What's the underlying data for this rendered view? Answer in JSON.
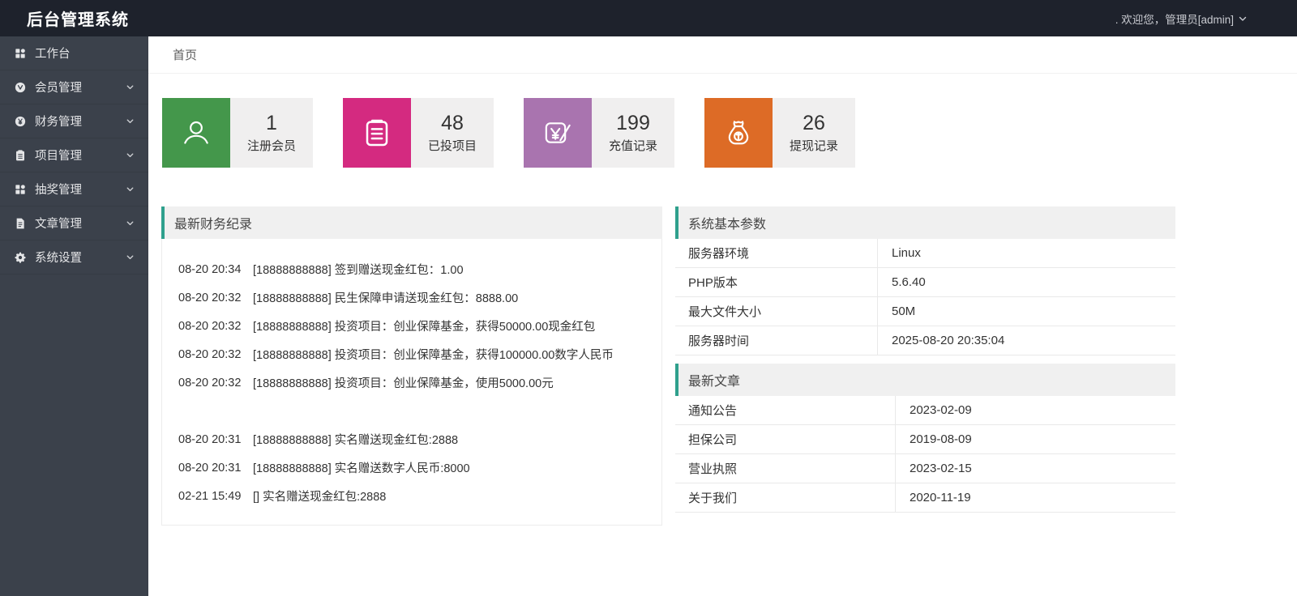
{
  "header": {
    "title": "后台管理系统",
    "user": {
      "greeting": ". 欢迎您，管理员[admin]",
      "chevron_icon": "chevron-down-icon"
    }
  },
  "sidebar": {
    "items": [
      {
        "icon": "dashboard-grid-icon",
        "label": "工作台",
        "expandable": false
      },
      {
        "icon": "member-badge-icon",
        "label": "会员管理",
        "expandable": true
      },
      {
        "icon": "finance-coin-icon",
        "label": "财务管理",
        "expandable": true
      },
      {
        "icon": "clipboard-icon",
        "label": "项目管理",
        "expandable": true
      },
      {
        "icon": "lottery-grid-icon",
        "label": "抽奖管理",
        "expandable": true
      },
      {
        "icon": "document-icon",
        "label": "文章管理",
        "expandable": true
      },
      {
        "icon": "gear-icon",
        "label": "系统设置",
        "expandable": true
      }
    ],
    "chevron_icon": "chevron-down-icon"
  },
  "breadcrumb": {
    "current": "首页"
  },
  "stat_cards": [
    {
      "icon": "user-icon",
      "color": "#44974b",
      "value": "1",
      "label": "注册会员"
    },
    {
      "icon": "clipboard-lines-icon",
      "color": "#d42a80",
      "value": "48",
      "label": "已投项目"
    },
    {
      "icon": "yen-edit-icon",
      "color": "#a974af",
      "value": "199",
      "label": "充值记录"
    },
    {
      "icon": "money-bag-icon",
      "color": "#dd6b26",
      "value": "26",
      "label": "提现记录"
    }
  ],
  "finance_panel": {
    "title": "最新财务纪录",
    "records": [
      {
        "time": "08-20 20:34",
        "text": "[18888888888] 签到赠送现金红包：1.00"
      },
      {
        "time": "08-20 20:32",
        "text": "[18888888888] 民生保障申请送现金红包：8888.00"
      },
      {
        "time": "08-20 20:32",
        "text": "[18888888888] 投资项目：创业保障基金，获得50000.00现金红包"
      },
      {
        "time": "08-20 20:32",
        "text": "[18888888888] 投资项目：创业保障基金，获得100000.00数字人民币"
      },
      {
        "time": "08-20 20:32",
        "text": "[18888888888] 投资项目：创业保障基金，使用5000.00元"
      },
      {
        "time": "",
        "text": ""
      },
      {
        "time": "08-20 20:31",
        "text": "[18888888888] 实名赠送现金红包:2888"
      },
      {
        "time": "08-20 20:31",
        "text": "[18888888888] 实名赠送数字人民币:8000"
      },
      {
        "time": "02-21 15:49",
        "text": "[] 实名赠送现金红包:2888"
      }
    ]
  },
  "system_panel": {
    "title": "系统基本参数",
    "rows": [
      {
        "label": "服务器环境",
        "value": "Linux"
      },
      {
        "label": "PHP版本",
        "value": "5.6.40"
      },
      {
        "label": "最大文件大小",
        "value": "50M"
      },
      {
        "label": "服务器时间",
        "value": "2025-08-20 20:35:04"
      }
    ]
  },
  "articles_panel": {
    "title": "最新文章",
    "rows": [
      {
        "label": "通知公告",
        "value": "2023-02-09"
      },
      {
        "label": "担保公司",
        "value": "2019-08-09"
      },
      {
        "label": "营业执照",
        "value": "2023-02-15"
      },
      {
        "label": "关于我们",
        "value": "2020-11-19"
      }
    ]
  },
  "colors": {
    "topbar_bg": "#1e222c",
    "sidebar_bg": "#3b414b",
    "panel_accent": "#2fa08d",
    "card_bg": "#f0efef",
    "stat_green": "#44974b",
    "stat_pink": "#d42a80",
    "stat_purple": "#a974af",
    "stat_orange": "#dd6b26"
  }
}
